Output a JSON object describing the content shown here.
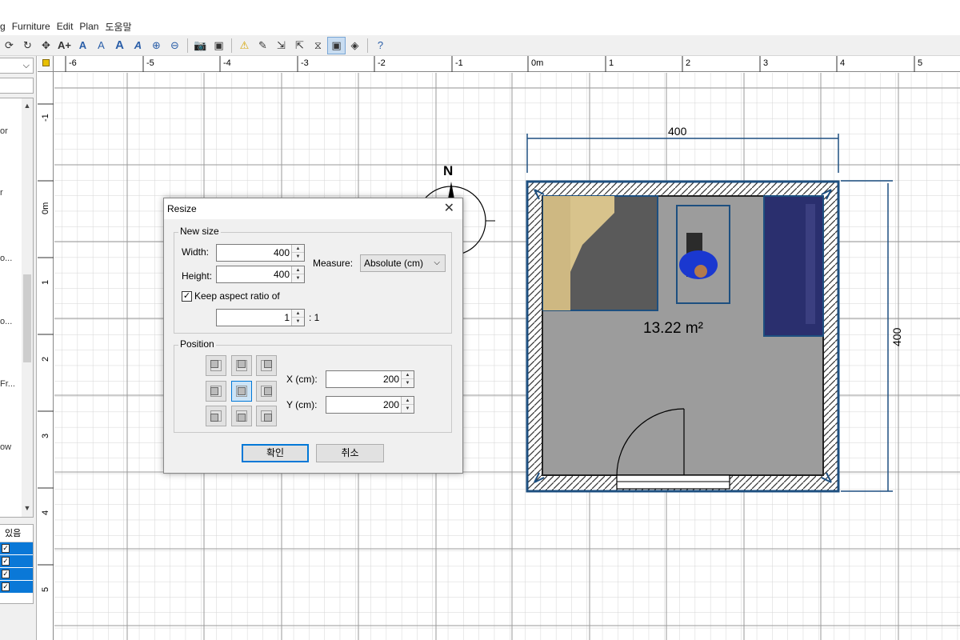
{
  "menu": {
    "items": [
      "g",
      "Furniture",
      "Edit",
      "Plan",
      "도움말"
    ]
  },
  "toolbar": {
    "icons": [
      "rotate-icon",
      "redo-icon",
      "move-icon",
      "add-text-icon",
      "text-style-1-icon",
      "text-style-2-icon",
      "text-style-3-icon",
      "text-style-4-icon",
      "zoom-in-icon",
      "zoom-out-icon",
      "photo-icon",
      "video-icon",
      "warning-icon",
      "edit-icon",
      "import-icon",
      "export-icon",
      "mirror-icon",
      "resize-icon",
      "paint-icon",
      "help-icon"
    ]
  },
  "left_panel": {
    "combo_arrow": "⌵",
    "tree_items": [
      "or",
      "r",
      "o...",
      "o...",
      "Fr...",
      "ow"
    ],
    "table_header": "있음"
  },
  "plan": {
    "ruler_top": [
      "-6",
      "-5",
      "-4",
      "-3",
      "-2",
      "-1",
      "0m",
      "1",
      "2",
      "3",
      "4",
      "5"
    ],
    "ruler_left": [
      "-1",
      "0m",
      "1",
      "2",
      "3",
      "4",
      "5"
    ],
    "dimension_width": "400",
    "dimension_height": "400",
    "room_area": "13.22 m²",
    "compass_label": "N"
  },
  "dialog": {
    "title": "Resize",
    "new_size_label": "New size",
    "width_label": "Width:",
    "width_value": "400",
    "height_label": "Height:",
    "height_value": "400",
    "measure_label": "Measure:",
    "measure_value": "Absolute (cm)",
    "keep_aspect_label": "Keep aspect ratio of",
    "keep_aspect_checked": true,
    "ratio_value": "1",
    "ratio_suffix": ": 1",
    "position_label": "Position",
    "x_label": "X (cm):",
    "x_value": "200",
    "y_label": "Y (cm):",
    "y_value": "200",
    "ok_label": "확인",
    "cancel_label": "취소"
  },
  "colors": {
    "accent": "#0078d7",
    "wall_outline": "#1d4f80",
    "floor": "#9c9c9c",
    "bed": "#2a2f6e"
  }
}
